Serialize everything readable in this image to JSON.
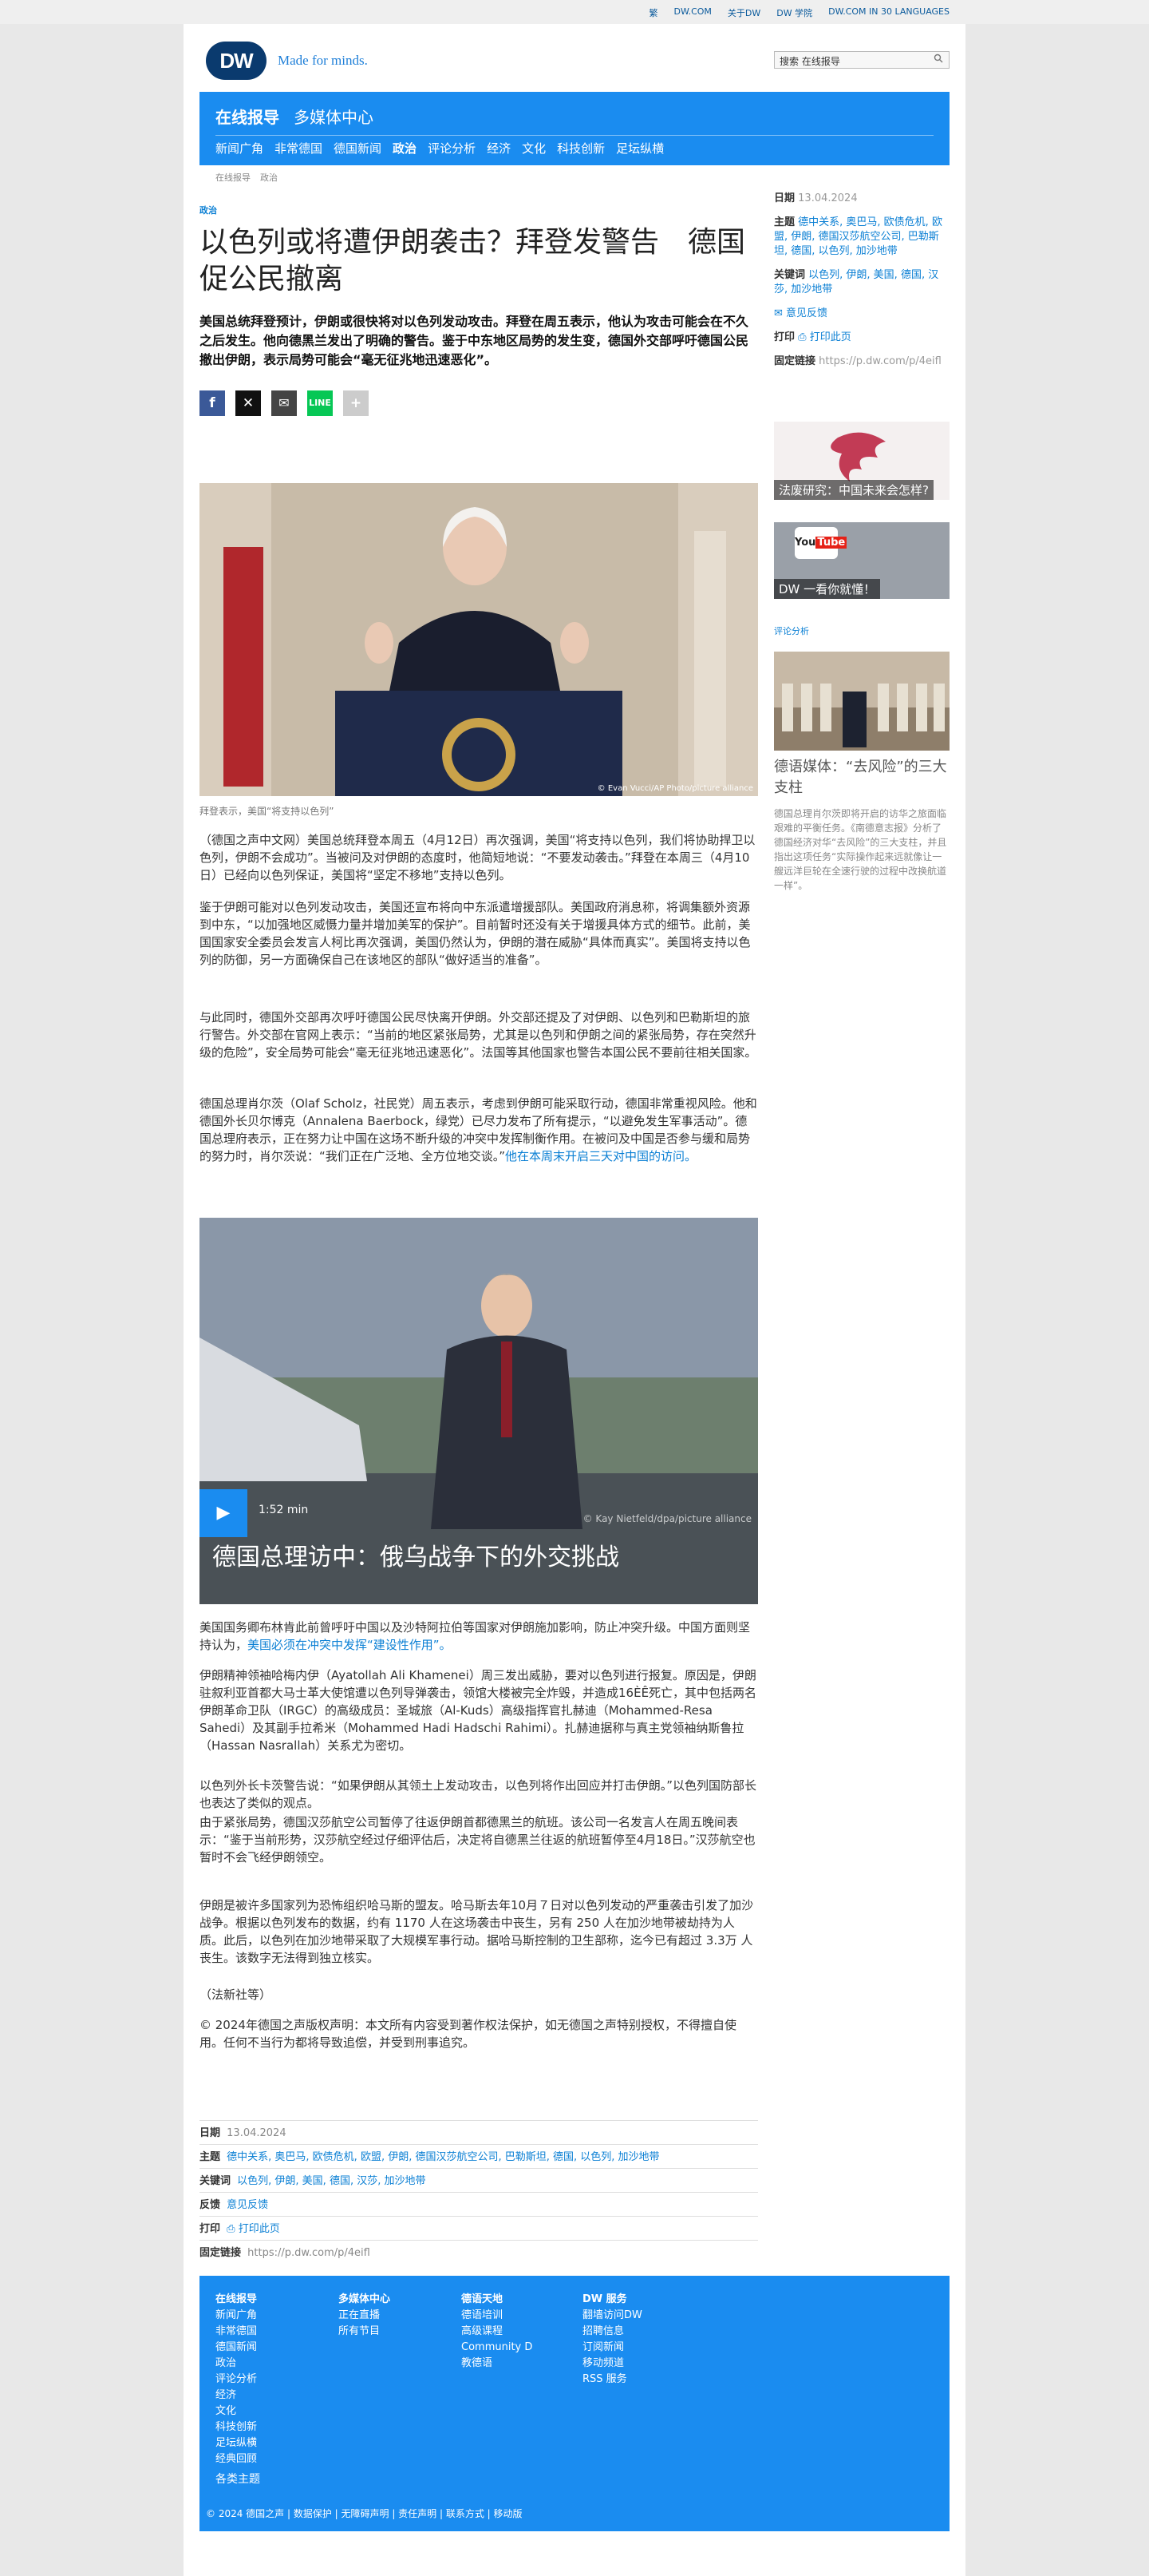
{
  "topbar": {
    "links": [
      "繁",
      "DW.COM",
      "关于DW",
      "DW 学院",
      "DW.COM IN 30 LANGUAGES"
    ]
  },
  "logo": {
    "mark": "DW",
    "tagline": "Made for minds."
  },
  "search": {
    "placeholder": "搜索 在线报导"
  },
  "header": {
    "main": [
      "在线报导",
      "多媒体中心"
    ],
    "nav": [
      "新闻广角",
      "非常德国",
      "德国新闻",
      "政治",
      "评论分析",
      "经济",
      "文化",
      "科技创新",
      "足坛纵横"
    ]
  },
  "breadcrumb": [
    "在线报导",
    "政治"
  ],
  "article": {
    "kicker": "政治",
    "title": "以色列或将遭伊朗袭击？拜登发警告　德国促公民撤离",
    "lead": "美国总统拜登预计，伊朗或很快将对以色列发动攻击。拜登在周五表示，他认为攻击可能会在不久之后发生。他向德黑兰发出了明确的警告。鉴于中东地区局势的发生变，德国外交部呼吁德国公民撤出伊朗，表示局势可能会“毫无征兆地迅速恶化”。",
    "photo_credit": "© Evan Vucci/AP Photo/picture alliance",
    "caption": "拜登表示，美国“将支持以色列”",
    "p1": "（德国之声中文网）美国总统拜登本周五（4月12日）再次强调，美国“将支持以色列，我们将协助捍卫以色列，伊朗不会成功”。当被问及对伊朗的态度时，他简短地说：“不要发动袭击。”拜登在本周三（4月10日）已经向以色列保证，美国将“坚定不移地”支持以色列。",
    "p2": "鉴于伊朗可能对以色列发动攻击，美国还宣布将向中东派遣增援部队。美国政府消息称，将调集额外资源到中东，“以加强地区威慑力量并增加美军的保护”。目前暂时还没有关于增援具体方式的细节。此前，美国国家安全委员会发言人柯比再次强调，美国仍然认为，伊朗的潜在威胁“具体而真实”。美国将支持以色列的防御，另一方面确保自己在该地区的部队“做好适当的准备”。",
    "p3": "与此同时，德国外交部再次呼吁德国公民尽快离开伊朗。外交部还提及了对伊朗、以色列和巴勒斯坦的旅行警告。外交部在官网上表示：“当前的地区紧张局势，尤其是以色列和伊朗之间的紧张局势，存在突然升级的危险”，安全局势可能会“毫无征兆地迅速恶化”。法国等其他国家也警告本国公民不要前往相关国家。",
    "p4": "德国总理肖尔茨（Olaf Scholz，社民党）周五表示，考虑到伊朗可能采取行动，德国非常重视风险。他和德国外长贝尔博克（Annalena Baerbock，绿党）已尽力发布了所有提示，“以避免发生军事活动”。德国总理府表示，正在努力让中国在这场不断升级的冲突中发挥制衡作用。在被问及中国是否参与缓和局势的努力时，肖尔茨说：“我们正在广泛地、全方位地交谈。”",
    "p4_link": "他在本周末开启三天对中国的访问。",
    "video": {
      "duration": "1:52 min",
      "credit": "© Kay Nietfeld/dpa/picture alliance",
      "title": "德国总理访中：俄乌战争下的外交挑战"
    },
    "p5": "美国国务卿布林肯此前曾呼吁中国以及沙特阿拉伯等国家对伊朗施加影响，防止冲突升级。中国方面则坚持认为，",
    "p5_link": "美国必须在冲突中发挥“建设性作用”。",
    "p6": "伊朗精神领袖哈梅内伊（Ayatollah Ali Khamenei）周三发出威胁，要对以色列进行报复。原因是，伊朗驻叙利亚首都大马士革大使馆遭以色列导弹袭击，领馆大楼被完全炸毁，并造成16ÈÊ死亡，其中包括两名伊朗革命卫队（IRGC）的高级成员：圣城旅（Al-Kuds）高级指挥官扎赫迪（Mohammed-Resa Sahedi）及其副手拉希米（Mohammed Hadi Hadschi Rahimi）。扎赫迪据称与真主党领袖纳斯鲁拉（Hassan Nasrallah）关系尤为密切。",
    "p7": "以色列外长卡茨警告说：“如果伊朗从其领土上发动攻击，以色列将作出回应并打击伊朗。”以色列国防部长也表达了类似的观点。",
    "p8": "由于紧张局势，德国汉莎航空公司暂停了往返伊朗首都德黑兰的航班。该公司一名发言人在周五晚间表示：“鉴于当前形势，汉莎航空经过仔细评估后，决定将自德黑兰往返的航班暂停至4月18日。”汉莎航空也暂时不会飞经伊朗领空。",
    "p9": "伊朗是被许多国家列为恐怖组织哈马斯的盟友。哈马斯去年10月７日对以色列发动的严重袭击引发了加沙战争。根据以色列发布的数据，约有 1170 人在这场袭击中丧生，另有 250 人在加沙地带被劫持为人质。此后，以色列在加沙地带采取了大规模军事行动。据哈马斯控制的卫生部称，迄今已有超过 3.3万 人丧生。该数字无法得到独立核实。",
    "p10": "（法新社等）",
    "p11": "© 2024年德国之声版权声明：本文所有内容受到著作权法保护，如无德国之声特别授权，不得擅自使用。任何不当行为都将导致追偿，并受到刑事追究。"
  },
  "meta": {
    "date_label": "日期",
    "date": "13.04.2024",
    "topics_label": "主题",
    "topics": "德中关系, 奥巴马, 欧债危机, 欧盟, 伊朗, 德国汉莎航空公司, 巴勒斯坦, 德国, 以色列, 加沙地带",
    "keywords_label": "关键词",
    "keywords": "以色列, 伊朗, 美国, 德国, 汉莎, 加沙地带",
    "feedback_label": "反馈",
    "feedback": "意见反馈",
    "print_label": "打印",
    "print": "打印此页",
    "link_label": "固定链接",
    "link": "https://p.dw.com/p/4eifl"
  },
  "sidebar": {
    "date_label": "日期",
    "date": "13.04.2024",
    "topics_label": "主题",
    "topics": "德中关系, 奥巴马, 欧债危机, 欧盟, 伊朗, 德国汉莎航空公司, 巴勒斯坦, 德国, 以色列, 加沙地带",
    "keywords_label": "关键词",
    "keywords": "以色列, 伊朗, 美国, 德国, 汉莎, 加沙地带",
    "feedback": "意见反馈",
    "print_label": "打印",
    "print": "打印此页",
    "link_label": "固定链接",
    "link": "https://p.dw.com/p/4eifl",
    "promo1": "法废研究：中国未来会怎样?",
    "promo2": "DW 一看你就懂！",
    "section": "评论分析",
    "teaser_title": "德语媒体：“去风险”的三大支柱",
    "teaser_text": "德国总理肖尔茨即将开启的访华之旅面临艰难的平衡任务。《南德意志报》分析了德国经济对华“去风险”的三大支柱，并且指出这项任务“实际操作起来远就像让一艘远洋巨轮在全速行驶的过程中改换航道一样”。"
  },
  "footer": {
    "col1_head": "在线报导",
    "col1": [
      "新闻广角",
      "非常德国",
      "德国新闻",
      "政治",
      "评论分析",
      "经济",
      "文化",
      "科技创新",
      "足坛纵横",
      "经典回顾"
    ],
    "col2_head": "多媒体中心",
    "col2": [
      "正在直播",
      "所有节目"
    ],
    "col3_head": "德语天地",
    "col3": [
      "德语培训",
      "高级课程",
      "Community D",
      "教德语"
    ],
    "col4_head": "DW 服务",
    "col4": [
      "翻墙访问DW",
      "招聘信息",
      "订阅新闻",
      "移动频道",
      "RSS 服务"
    ],
    "more": "各类主题",
    "copyright": "© 2024 德国之声 | 数据保护 | 无障碍声明 | 责任声明 | 联系方式 | 移动版"
  },
  "colors": {
    "brand_blue": "#1a8cf0",
    "logo_navy": "#0a3a6e",
    "link": "#0a7fd4"
  }
}
